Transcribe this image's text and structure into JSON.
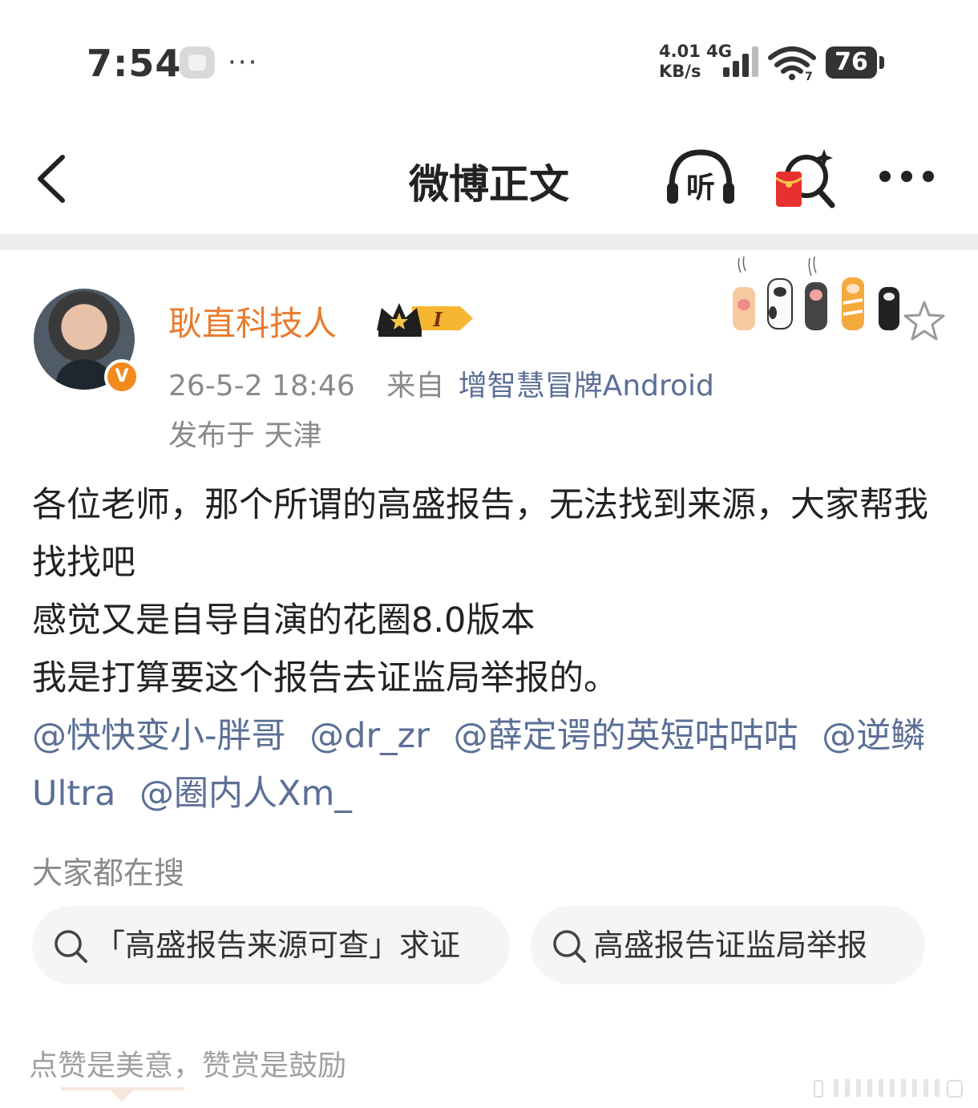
{
  "status_bar": {
    "time": "7:54",
    "more": "···",
    "net_speed": "4.01",
    "net_unit": "KB/s",
    "network": "4G",
    "battery": "76",
    "icons": [
      "app-notification-icon",
      "signal-icon",
      "wifi-icon",
      "battery-icon"
    ]
  },
  "nav": {
    "title": "微博正文",
    "listen_label": "听",
    "icons": [
      "back-icon",
      "listen-icon",
      "red-packet-search-icon",
      "more-icon"
    ]
  },
  "author": {
    "name": "耿直科技人",
    "level_badge": "I",
    "verified": "V",
    "timestamp": "26-5-2 18:46",
    "from_label": "来自",
    "source": "增智慧冒牌Android",
    "location": "发布于 天津"
  },
  "post": {
    "lines": [
      "各位老师，那个所谓的高盛报告，无法找到来源，大家帮我找找吧",
      "感觉又是自导自演的花圈8.0版本",
      "我是打算要这个报告去证监局举报的。"
    ],
    "mentions": [
      "@快快变小-胖哥",
      "@dr_zr",
      "@薛定谔的英短咕咕咕",
      "@逆鳞Ultra",
      "@圈内人Xm_"
    ]
  },
  "trending": {
    "title": "大家都在搜",
    "chips": [
      "「高盛报告来源可查」求证",
      "高盛报告证监局举报"
    ]
  },
  "footer": {
    "note": "点赞是美意，赞赏是鼓励"
  },
  "colors": {
    "author_name": "#e87b2e",
    "link": "#5b6f96",
    "meta": "#8a8a8a",
    "divider": "#eeeeee",
    "chip_bg": "#f5f5f5",
    "verified": "#f28a1d"
  }
}
